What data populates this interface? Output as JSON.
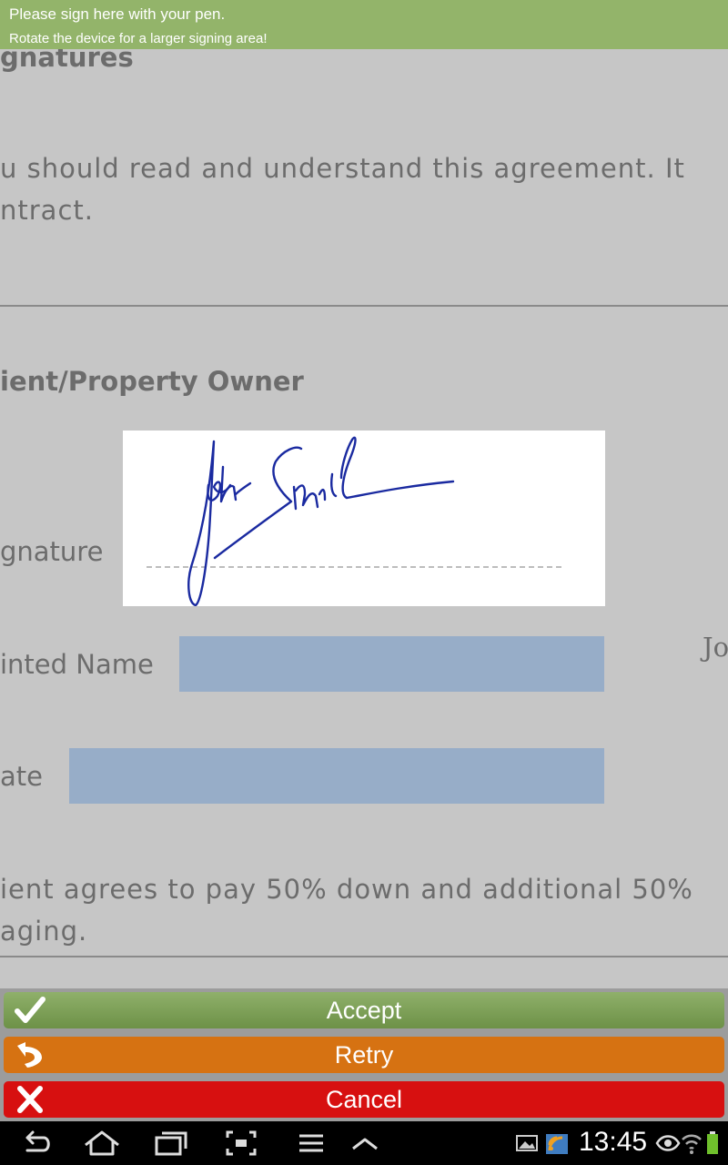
{
  "banner": {
    "line1": "Please sign here with your pen.",
    "line2": "Rotate the device for a larger signing area!"
  },
  "document": {
    "heading_signatures": "gnatures",
    "paragraph1_line1": "u should read and understand this agreement. It",
    "paragraph1_line2": "ntract.",
    "heading_owner": "ient/Property Owner",
    "signature_label": "gnature",
    "printed_name_label": "inted Name",
    "printed_name_value": "Jo",
    "date_label": "ate",
    "paragraph2_line1": "ient agrees to pay 50% down and additional 50%",
    "paragraph2_line2": "aging."
  },
  "buttons": {
    "accept": "Accept",
    "retry": "Retry",
    "cancel": "Cancel"
  },
  "status_bar": {
    "time": "13:45"
  },
  "colors": {
    "banner": "#93b46a",
    "accept": "#7aa057",
    "retry": "#d67212",
    "cancel": "#d71010",
    "field": "#97adc8",
    "ink": "#1a2aa0"
  }
}
